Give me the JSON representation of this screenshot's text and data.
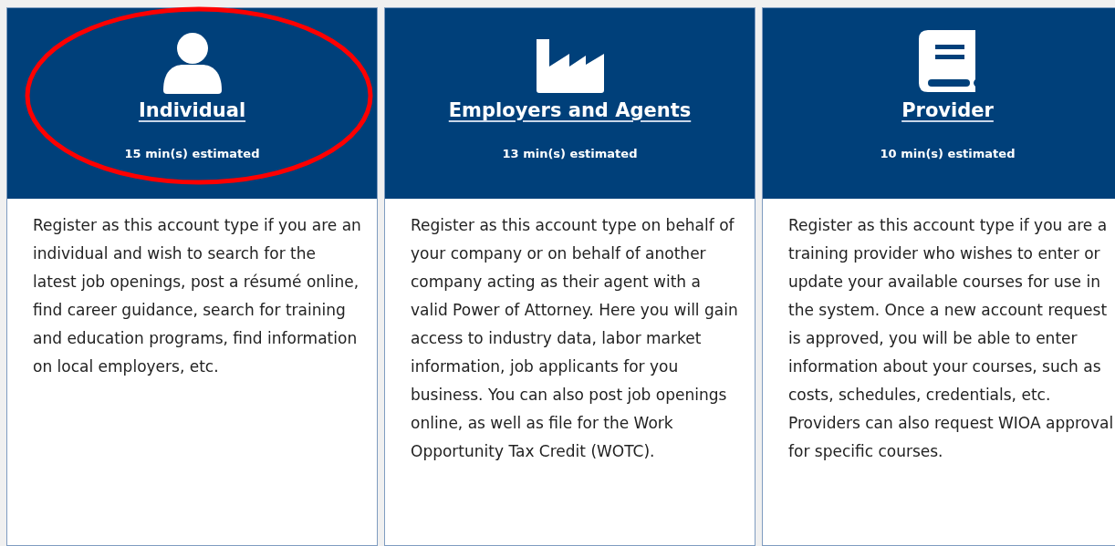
{
  "cards": [
    {
      "kind": "person",
      "title": "Individual",
      "estimate": "15 min(s) estimated",
      "highlighted": true,
      "description": "Register as this account type if you are an individual and wish to search for the latest job openings, post a résumé online, find career guidance, search for training and education programs, find information on local employers, etc."
    },
    {
      "kind": "factory",
      "title": "Employers and Agents",
      "estimate": "13 min(s) estimated",
      "highlighted": false,
      "description": "Register as this account type on behalf of your company or on behalf of another company acting as their agent with a valid Power of Attorney. Here you will gain access to industry data, labor market information, job applicants for you business. You can also post job openings online, as well as file for the Work Opportunity Tax Credit (WOTC)."
    },
    {
      "kind": "book",
      "title": "Provider",
      "estimate": "10 min(s) estimated",
      "highlighted": false,
      "description": "Register as this account type if you are a training provider who wishes to enter or update your available courses for use in the system. Once a new account request is approved, you will be able to enter information about your courses, such as costs, schedules, credentials, etc. Providers can also request WIOA approval for specific courses."
    }
  ]
}
